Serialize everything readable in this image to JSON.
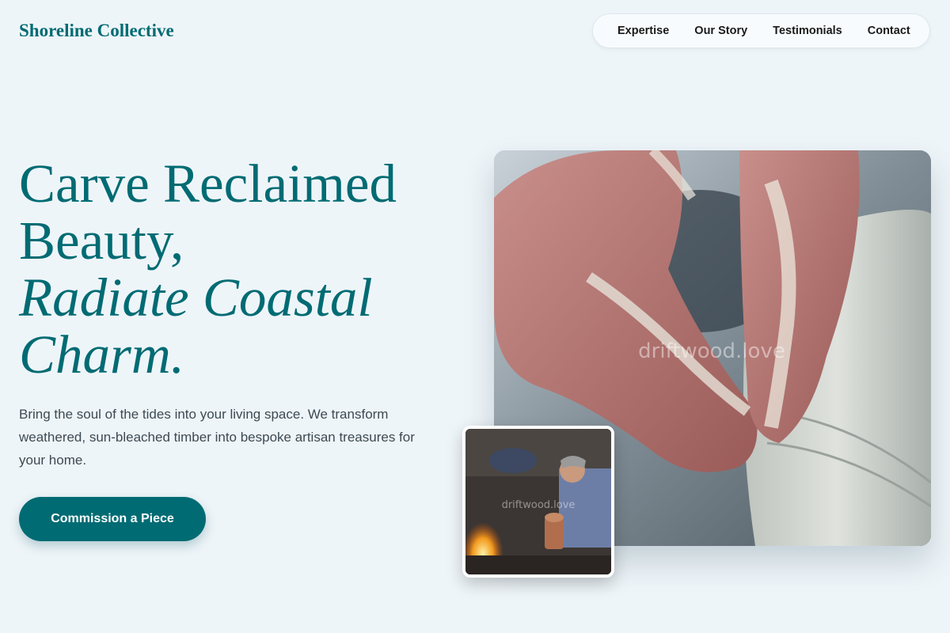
{
  "brand": {
    "name": "Shoreline Collective"
  },
  "nav": {
    "items": [
      "Expertise",
      "Our Story",
      "Testimonials",
      "Contact"
    ]
  },
  "hero": {
    "headline_line1": "Carve Reclaimed",
    "headline_line2": "Beauty,",
    "headline_italic_line1": "Radiate Coastal",
    "headline_italic_line2": "Charm.",
    "description": "Bring the soul of the tides into your living space. We transform weathered, sun-bleached timber into bespoke artisan treasures for your home.",
    "cta_label": "Commission a Piece"
  },
  "images": {
    "main_watermark": "driftwood.love",
    "thumb_watermark": "driftwood.love"
  },
  "colors": {
    "accent": "#006b73",
    "background": "#eef5f9"
  }
}
